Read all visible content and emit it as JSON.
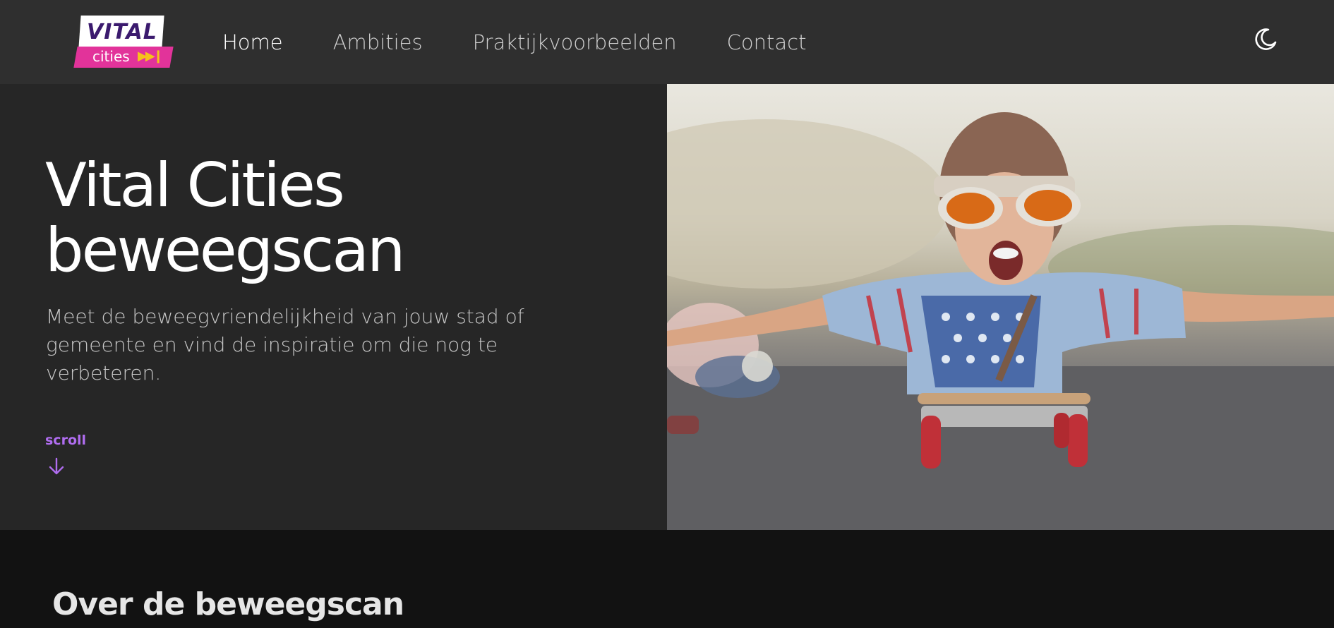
{
  "brand": {
    "logo_top": "VITAL",
    "logo_bottom": "cities",
    "colors": {
      "purple": "#3b1a6e",
      "pink": "#e2339a",
      "yellow": "#f6c21b"
    }
  },
  "nav": {
    "items": [
      {
        "label": "Home",
        "active": true
      },
      {
        "label": "Ambities",
        "active": false
      },
      {
        "label": "Praktijkvoorbeelden",
        "active": false
      },
      {
        "label": "Contact",
        "active": false
      }
    ],
    "theme_toggle_icon": "moon-icon"
  },
  "hero": {
    "title": "Vital Cities beweegscan",
    "subtitle": "Meet de beweegvriendelijkheid van jouw stad of gemeente en vind de inspiratie om die nog te verbeteren.",
    "scroll_label": "scroll",
    "scroll_icon": "arrow-down-icon",
    "accent_color": "#b06df0",
    "image": "photo of a child with aviator cap and goggles lying on a skateboard with arms spread"
  },
  "section": {
    "title": "Over de beweegscan"
  }
}
